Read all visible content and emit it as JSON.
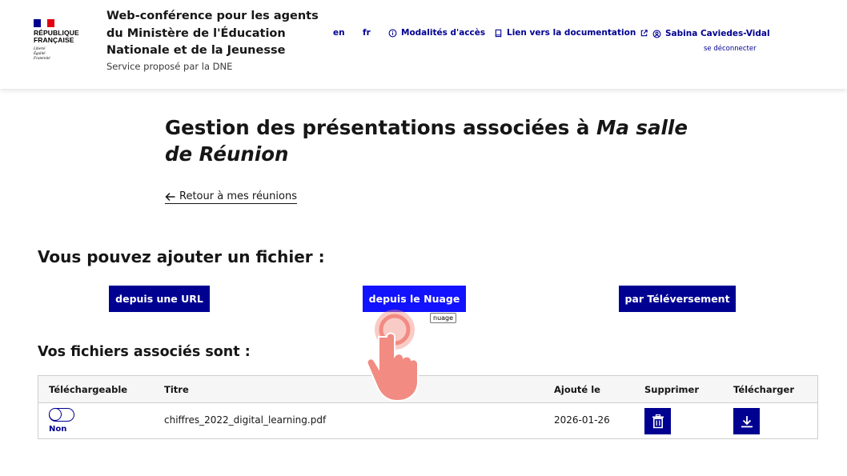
{
  "header": {
    "logo": {
      "line1": "RÉPUBLIQUE",
      "line2": "FRANÇAISE",
      "motto": [
        "Liberté",
        "Égalité",
        "Fraternité"
      ]
    },
    "service_title": "Web-conférence pour les agents du Ministère de l'Éducation Nationale et de la Jeunesse",
    "service_subtitle": "Service proposé par la DNE",
    "links": {
      "lang_en": "en",
      "lang_fr": "fr",
      "access": "Modalités d'accès",
      "docs": "Lien vers la documentation",
      "user": "Sabina Caviedes-Vidal",
      "logout": "se déconnecter"
    }
  },
  "main": {
    "title_prefix": "Gestion des présentations associées à ",
    "title_room": "Ma salle de Réunion",
    "back_link": "Retour à mes réunions",
    "add_heading": "Vous pouvez ajouter un fichier :",
    "buttons": {
      "url": "depuis une URL",
      "cloud": "depuis le Nuage",
      "upload": "par Téléversement"
    },
    "tooltip": "nuage",
    "files_heading": "Vos fichiers associés sont :",
    "table": {
      "headers": [
        "Téléchargeable",
        "Titre",
        "Ajouté le",
        "Supprimer",
        "Télécharger"
      ],
      "rows": [
        {
          "downloadable": "Non",
          "title": "chiffres_2022_digital_learning.pdf",
          "added": "2026-01-26"
        }
      ]
    }
  },
  "colors": {
    "primary": "#000091",
    "flag_blue": "#000091",
    "flag_red": "#e1000f",
    "cursor": "#f28b82"
  }
}
